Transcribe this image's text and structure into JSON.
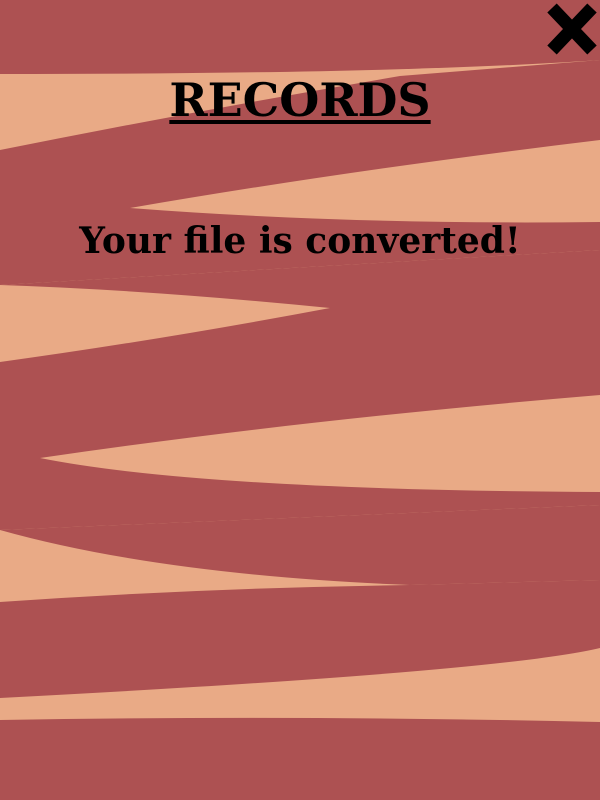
{
  "screen": {
    "title": "RECORDS",
    "message": "Your file is converted!"
  },
  "close_button": {
    "icon": "close-icon"
  },
  "colors": {
    "background_light": "#E9AA86",
    "background_dark": "#AD5152",
    "text": "#000000"
  }
}
